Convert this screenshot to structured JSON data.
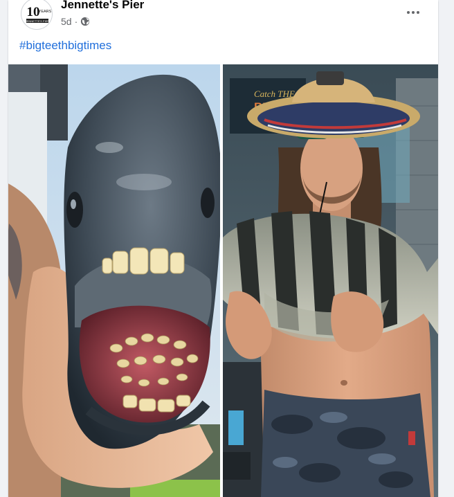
{
  "post": {
    "page_name": "Jennette's Pier",
    "timestamp": "5d",
    "separator": "·",
    "audience_icon": "globe-icon",
    "more_icon": "more-options-icon",
    "hashtag": "#bigteethbigtimes",
    "avatar_logo": {
      "number": "10",
      "word": "YEARS",
      "caption": "JENNETTE'S PIER"
    }
  },
  "photos": [
    {
      "name": "sheepshead-teeth-closeup-photo"
    },
    {
      "name": "man-holding-sheepshead-photo",
      "sign_text_line1": "Catch THE",
      "sign_text_line2": "BIG ONES"
    }
  ],
  "colors": {
    "link": "#216fdb",
    "secondary_text": "#65676b",
    "primary_text": "#050505",
    "background": "#f0f2f5"
  }
}
